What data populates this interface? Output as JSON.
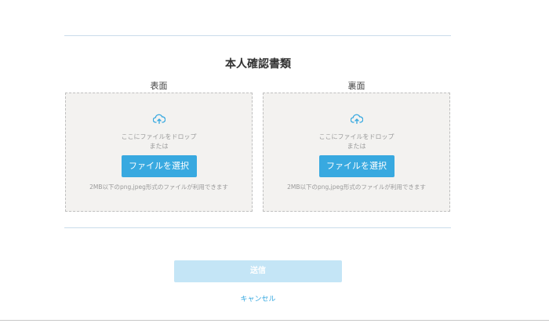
{
  "section": {
    "title": "本人確認書類"
  },
  "front": {
    "label": "表面",
    "drop_text": "ここにファイルをドロップ",
    "or_text": "または",
    "button_label": "ファイルを選択",
    "note": "2MB以下のpng,jpeg形式のファイルが利用できます"
  },
  "back": {
    "label": "裏面",
    "drop_text": "ここにファイルをドロップ",
    "or_text": "または",
    "button_label": "ファイルを選択",
    "note": "2MB以下のpng,jpeg形式のファイルが利用できます"
  },
  "actions": {
    "submit_label": "送信",
    "submit_enabled": false,
    "cancel_label": "キャンセル"
  },
  "icons": {
    "upload": "cloud-upload-icon"
  },
  "colors": {
    "accent": "#38a9e0",
    "submit_disabled": "#c4e5f6",
    "dropzone_bg": "#f3f2f0",
    "divider": "#c9dcea"
  }
}
